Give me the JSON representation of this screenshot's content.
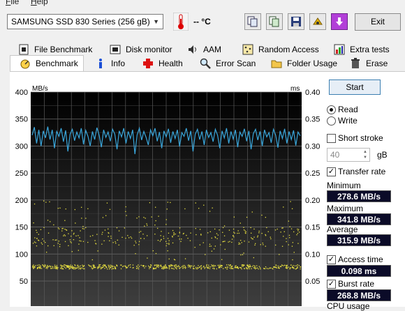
{
  "menu": {
    "file": "File",
    "help": "Help"
  },
  "toolbar": {
    "drive": "SAMSUNG SSD 830 Series (256 gB)",
    "temperature": "-- °C",
    "exit_label": "Exit"
  },
  "tabs_row1": [
    {
      "label": "File Benchmark"
    },
    {
      "label": "Disk monitor"
    },
    {
      "label": "AAM"
    },
    {
      "label": "Random Access"
    },
    {
      "label": "Extra tests"
    }
  ],
  "tabs_row2": [
    {
      "label": "Benchmark",
      "active": true
    },
    {
      "label": "Info"
    },
    {
      "label": "Health"
    },
    {
      "label": "Error Scan"
    },
    {
      "label": "Folder Usage"
    },
    {
      "label": "Erase"
    }
  ],
  "controls": {
    "start_label": "Start",
    "read_label": "Read",
    "write_label": "Write",
    "mode_selected": "Read",
    "short_stroke_label": "Short stroke",
    "short_stroke_checked": false,
    "short_stroke_value": "40",
    "short_stroke_unit": "gB",
    "transfer_rate_label": "Transfer rate",
    "transfer_rate_checked": true,
    "minimum_label": "Minimum",
    "minimum_value": "278.6 MB/s",
    "maximum_label": "Maximum",
    "maximum_value": "341.8 MB/s",
    "average_label": "Average",
    "average_value": "315.9 MB/s",
    "access_time_label": "Access time",
    "access_time_checked": true,
    "access_time_value": "0.098 ms",
    "burst_rate_label": "Burst rate",
    "burst_rate_checked": true,
    "burst_rate_value": "268.8 MB/s",
    "cpu_usage_label": "CPU usage"
  },
  "chart_data": {
    "type": "line",
    "left_unit": "MB/s",
    "right_unit": "ms",
    "left_ticks": [
      "400",
      "350",
      "300",
      "250",
      "200",
      "150",
      "100",
      "50"
    ],
    "right_ticks": [
      "0.40",
      "0.35",
      "0.30",
      "0.25",
      "0.20",
      "0.15",
      "0.10",
      "0.05"
    ],
    "y_left_range": [
      0,
      400
    ],
    "y_right_range": [
      0,
      0.4
    ],
    "grid": true,
    "series": [
      {
        "color": "#3aa7dc",
        "values": [
          320,
          335,
          305,
          330,
          300,
          328,
          315,
          336,
          312,
          330,
          296,
          327,
          318,
          333,
          308,
          329,
          290,
          322,
          331,
          310,
          326,
          315,
          333,
          303,
          329,
          318,
          300,
          327,
          312,
          334,
          320,
          298,
          330,
          316,
          326,
          309,
          331,
          322,
          294,
          328,
          317,
          333,
          305,
          327,
          314,
          330,
          285,
          321,
          333,
          311,
          327,
          316,
          302,
          330,
          319,
          333,
          309,
          326,
          296,
          328,
          317,
          332,
          306,
          327,
          314,
          330,
          299,
          325,
          318,
          333,
          310,
          328,
          290,
          322,
          331,
          312,
          327,
          302,
          330,
          316,
          325,
          308,
          331,
          320,
          296,
          328,
          315,
          333,
          305,
          327,
          313,
          330,
          298,
          326,
          318,
          332,
          309,
          328,
          294,
          323,
          331,
          311,
          327,
          300,
          330,
          317,
          325,
          306,
          331,
          320,
          297,
          328,
          314,
          332,
          305,
          327,
          312,
          329,
          301,
          326,
          319
        ]
      }
    ],
    "access_time_points_ms": "scatter, concentrated ~0.08 ms with spread 0.10–0.20 ms"
  }
}
